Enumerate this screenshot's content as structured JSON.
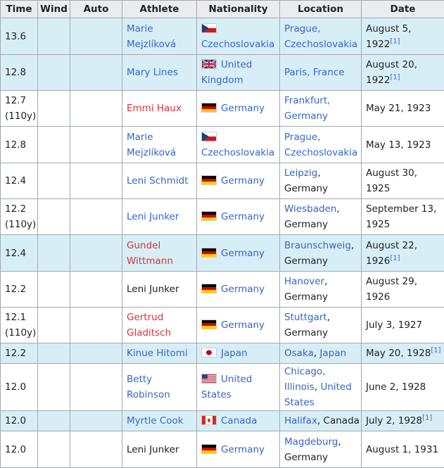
{
  "headers": [
    "Time",
    "Wind",
    "Auto",
    "Athlete",
    "Nationality",
    "Location",
    "Date"
  ],
  "rows": [
    {
      "highlight": true,
      "time": "13.6",
      "wind": "",
      "auto": "",
      "athlete": [
        {
          "t": "Marie Mejzlíková",
          "k": "link"
        }
      ],
      "flag": "czechoslovakia-flag",
      "nation": [
        {
          "t": "Czechoslovakia",
          "k": "link"
        }
      ],
      "location": [
        {
          "t": "Prague, Czechoslovakia",
          "k": "link"
        }
      ],
      "date": "August 5, 1922",
      "ref": "[1]"
    },
    {
      "highlight": true,
      "time": "12.8",
      "wind": "",
      "auto": "",
      "athlete": [
        {
          "t": "Mary Lines",
          "k": "link"
        }
      ],
      "flag": "united-kingdom-flag",
      "nation": [
        {
          "t": "United Kingdom",
          "k": "link"
        }
      ],
      "location": [
        {
          "t": "Paris, France",
          "k": "link"
        }
      ],
      "date": "August 20, 1922",
      "ref": "[1]"
    },
    {
      "highlight": false,
      "time": "12.7 (110y)",
      "wind": "",
      "auto": "",
      "athlete": [
        {
          "t": "Emmi Haux",
          "k": "new"
        }
      ],
      "flag": "germany-flag",
      "nation": [
        {
          "t": "Germany",
          "k": "link"
        }
      ],
      "location": [
        {
          "t": "Frankfurt, Germany",
          "k": "link"
        }
      ],
      "date": "May 21, 1923",
      "ref": ""
    },
    {
      "highlight": false,
      "time": "12.8",
      "wind": "",
      "auto": "",
      "athlete": [
        {
          "t": "Marie Mejzlíková",
          "k": "link"
        }
      ],
      "flag": "czechoslovakia-flag",
      "nation": [
        {
          "t": "Czechoslovakia",
          "k": "link"
        }
      ],
      "location": [
        {
          "t": "Prague, Czechoslovakia",
          "k": "link"
        }
      ],
      "date": "May 13, 1923",
      "ref": ""
    },
    {
      "highlight": false,
      "time": "12.4",
      "wind": "",
      "auto": "",
      "athlete": [
        {
          "t": "Leni Schmidt",
          "k": "link"
        }
      ],
      "flag": "germany-flag",
      "nation": [
        {
          "t": "Germany",
          "k": "link"
        }
      ],
      "location": [
        {
          "t": "Leipzig",
          "k": "link"
        },
        {
          "t": ", Germany",
          "k": "text"
        }
      ],
      "date": "August 30, 1925",
      "ref": ""
    },
    {
      "highlight": false,
      "time": "12.2 (110y)",
      "wind": "",
      "auto": "",
      "athlete": [
        {
          "t": "Leni Junker",
          "k": "link"
        }
      ],
      "flag": "germany-flag",
      "nation": [
        {
          "t": "Germany",
          "k": "link"
        }
      ],
      "location": [
        {
          "t": "Wiesbaden",
          "k": "link"
        },
        {
          "t": ", Germany",
          "k": "text"
        }
      ],
      "date": "September 13, 1925",
      "ref": ""
    },
    {
      "highlight": true,
      "time": "12.4",
      "wind": "",
      "auto": "",
      "athlete": [
        {
          "t": "Gundel Wittmann",
          "k": "new"
        }
      ],
      "flag": "germany-flag",
      "nation": [
        {
          "t": "Germany",
          "k": "link"
        }
      ],
      "location": [
        {
          "t": "Braunschweig",
          "k": "link"
        },
        {
          "t": ", Germany",
          "k": "text"
        }
      ],
      "date": "August 22, 1926",
      "ref": "[1]"
    },
    {
      "highlight": false,
      "time": "12.2",
      "wind": "",
      "auto": "",
      "athlete": [
        {
          "t": "Leni Junker",
          "k": "text"
        }
      ],
      "flag": "germany-flag",
      "nation": [
        {
          "t": "Germany",
          "k": "link"
        }
      ],
      "location": [
        {
          "t": "Hanover",
          "k": "link"
        },
        {
          "t": ", Germany",
          "k": "text"
        }
      ],
      "date": "August 29, 1926",
      "ref": ""
    },
    {
      "highlight": false,
      "time": "12.1 (110y)",
      "wind": "",
      "auto": "",
      "athlete": [
        {
          "t": "Gertrud Gladitsch",
          "k": "new"
        }
      ],
      "flag": "germany-flag",
      "nation": [
        {
          "t": "Germany",
          "k": "link"
        }
      ],
      "location": [
        {
          "t": "Stuttgart",
          "k": "link"
        },
        {
          "t": ", Germany",
          "k": "text"
        }
      ],
      "date": "July 3, 1927",
      "ref": ""
    },
    {
      "highlight": true,
      "time": "12.2",
      "wind": "",
      "auto": "",
      "athlete": [
        {
          "t": "Kinue Hitomi",
          "k": "link"
        }
      ],
      "flag": "japan-flag",
      "nation": [
        {
          "t": "Japan",
          "k": "link"
        }
      ],
      "location": [
        {
          "t": "Osaka",
          "k": "link"
        },
        {
          "t": ", ",
          "k": "text"
        },
        {
          "t": "Japan",
          "k": "link"
        }
      ],
      "date": "May 20, 1928",
      "ref": "[1]"
    },
    {
      "highlight": false,
      "time": "12.0",
      "wind": "",
      "auto": "",
      "athlete": [
        {
          "t": "Betty Robinson",
          "k": "link"
        }
      ],
      "flag": "united-states-flag",
      "nation": [
        {
          "t": "United States",
          "k": "link"
        }
      ],
      "location": [
        {
          "t": "Chicago, Illinois",
          "k": "link"
        },
        {
          "t": ", ",
          "k": "text"
        },
        {
          "t": "United States",
          "k": "link"
        }
      ],
      "date": "June 2, 1928",
      "ref": ""
    },
    {
      "highlight": true,
      "time": "12.0",
      "wind": "",
      "auto": "",
      "athlete": [
        {
          "t": "Myrtle Cook",
          "k": "link"
        }
      ],
      "flag": "canada-flag",
      "nation": [
        {
          "t": "Canada",
          "k": "link"
        }
      ],
      "location": [
        {
          "t": "Halifax",
          "k": "link"
        },
        {
          "t": ", Canada",
          "k": "text"
        }
      ],
      "date": "July 2, 1928",
      "ref": "[1]"
    },
    {
      "highlight": false,
      "time": "12.0",
      "wind": "",
      "auto": "",
      "athlete": [
        {
          "t": "Leni Junker",
          "k": "text"
        }
      ],
      "flag": "germany-flag",
      "nation": [
        {
          "t": "Germany",
          "k": "link"
        }
      ],
      "location": [
        {
          "t": "Magdeburg",
          "k": "link"
        },
        {
          "t": ", Germany",
          "k": "text"
        }
      ],
      "date": "August 1, 1931",
      "ref": ""
    }
  ],
  "colors": {
    "link": "#3366cc",
    "redlink": "#d73333",
    "highlight_row": "#d8eef7",
    "header_bg": "#eaecf0",
    "border": "#a2a9b1"
  }
}
